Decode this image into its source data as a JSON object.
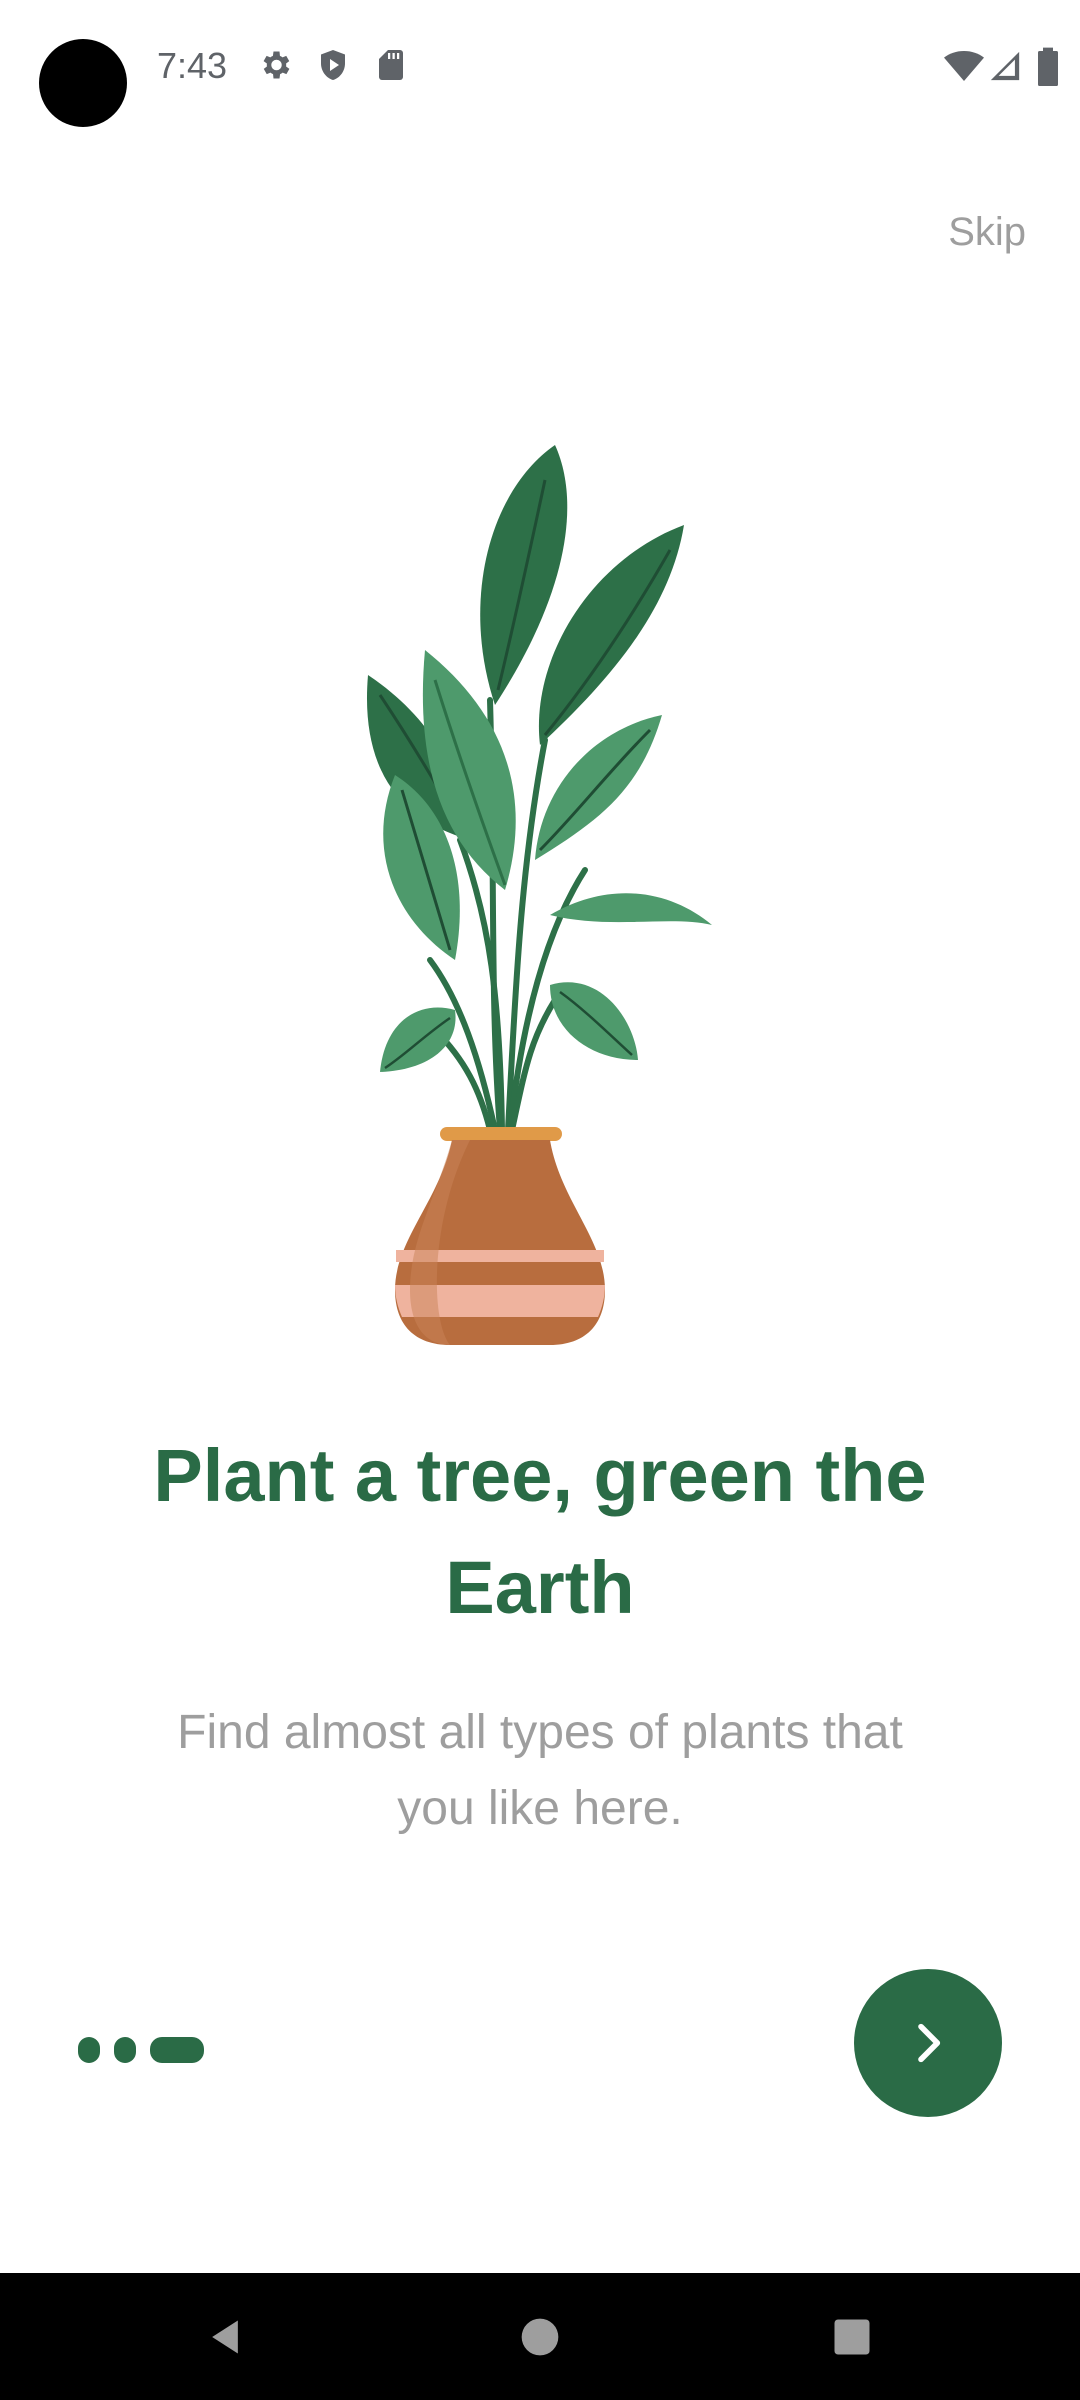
{
  "status_bar": {
    "time": "7:43",
    "left_icons": [
      "gear-icon",
      "shield-play-icon",
      "sd-card-icon"
    ],
    "right_icons": [
      "wifi-icon",
      "signal-icon",
      "battery-icon"
    ]
  },
  "header": {
    "skip_label": "Skip"
  },
  "onboarding": {
    "title": "Plant a tree, green the Earth",
    "subtitle": "Find almost all types of plants that you like here.",
    "page_count": 3,
    "current_page": 3
  },
  "nav_bar": {
    "buttons": [
      "back-icon",
      "home-icon",
      "recents-icon"
    ]
  },
  "colors": {
    "primary": "#2a6b46",
    "muted_text": "#9e9e9e",
    "background": "#ffffff",
    "pot": "#b86d3e",
    "pot_stripe": "#efb39e",
    "leaf_dark": "#2d7048",
    "leaf_light": "#4e9a6c"
  }
}
